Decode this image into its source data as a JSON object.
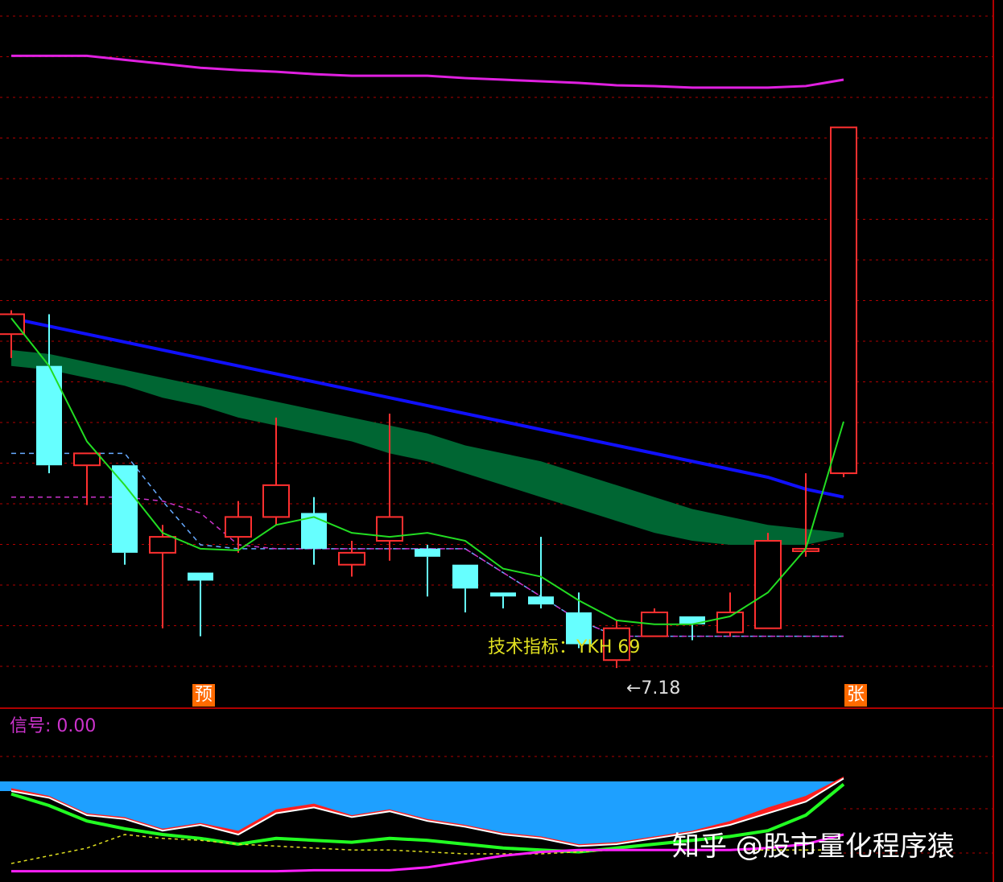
{
  "colors": {
    "background": "#000000",
    "grid": "#b00000",
    "up": "#ff3030",
    "down": "#66ffff",
    "ma_fast": "#22dd22",
    "ma_long": "#1010ff",
    "band": "#006633",
    "upper": "#e020e0",
    "support": "#cc33cc",
    "stop": "#66aaff",
    "label_bg": "#ff6a00",
    "text_yellow": "#e0e020",
    "text_magenta": "#cc33cc",
    "text_white": "#dddddd",
    "blue_fill": "#1ea0ff",
    "red_fill": "#ff2020"
  },
  "main": {
    "markers": {
      "pre": "预",
      "rise": "张"
    },
    "indicator_label": "技术指标",
    "indicator_value": "YKH 69",
    "low_price_note": "←7.18"
  },
  "sub": {
    "signal_label": "信号",
    "signal_value": "0.00"
  },
  "watermark": "知乎 @股市量化程序猿",
  "chart_data": [
    {
      "type": "candlestick",
      "title": "",
      "xlabel": "",
      "ylabel": "",
      "ylim": [
        6.2,
        14.5
      ],
      "candles": [
        {
          "o": 10.5,
          "h": 10.8,
          "l": 10.2,
          "c": 10.75
        },
        {
          "o": 10.1,
          "h": 10.75,
          "l": 8.75,
          "c": 8.85
        },
        {
          "o": 8.85,
          "h": 9.0,
          "l": 8.35,
          "c": 9.0
        },
        {
          "o": 8.85,
          "h": 8.85,
          "l": 7.6,
          "c": 7.75
        },
        {
          "o": 7.75,
          "h": 8.1,
          "l": 6.8,
          "c": 7.95
        },
        {
          "o": 7.5,
          "h": 7.5,
          "l": 6.7,
          "c": 7.4
        },
        {
          "o": 7.95,
          "h": 8.4,
          "l": 7.75,
          "c": 8.2
        },
        {
          "o": 8.2,
          "h": 9.45,
          "l": 8.1,
          "c": 8.6
        },
        {
          "o": 8.25,
          "h": 8.45,
          "l": 7.6,
          "c": 7.8
        },
        {
          "o": 7.6,
          "h": 7.9,
          "l": 7.45,
          "c": 7.75
        },
        {
          "o": 7.9,
          "h": 9.5,
          "l": 7.65,
          "c": 8.2
        },
        {
          "o": 7.8,
          "h": 7.85,
          "l": 7.2,
          "c": 7.7
        },
        {
          "o": 7.6,
          "h": 7.6,
          "l": 7.0,
          "c": 7.3
        },
        {
          "o": 7.25,
          "h": 7.25,
          "l": 7.05,
          "c": 7.2
        },
        {
          "o": 7.2,
          "h": 7.95,
          "l": 7.05,
          "c": 7.1
        },
        {
          "o": 7.0,
          "h": 7.25,
          "l": 6.55,
          "c": 6.6
        },
        {
          "o": 6.4,
          "h": 6.9,
          "l": 6.3,
          "c": 6.8
        },
        {
          "o": 6.7,
          "h": 7.05,
          "l": 6.7,
          "c": 7.0
        },
        {
          "o": 6.95,
          "h": 6.95,
          "l": 6.65,
          "c": 6.85
        },
        {
          "o": 6.75,
          "h": 7.25,
          "l": 6.7,
          "c": 7.0
        },
        {
          "o": 6.8,
          "h": 8.0,
          "l": 6.8,
          "c": 7.9
        },
        {
          "o": 7.8,
          "h": 8.75,
          "l": 7.7,
          "c": 7.8
        },
        {
          "o": 8.75,
          "h": 13.1,
          "l": 8.7,
          "c": 13.1
        }
      ],
      "ma_fast": [
        10.7,
        10.1,
        9.15,
        8.6,
        8.0,
        7.8,
        7.78,
        8.1,
        8.2,
        8.0,
        7.95,
        8.0,
        7.9,
        7.55,
        7.45,
        7.15,
        6.9,
        6.85,
        6.85,
        6.95,
        7.25,
        7.8,
        9.4
      ],
      "ma_long": [
        10.7,
        10.6,
        10.5,
        10.4,
        10.3,
        10.2,
        10.1,
        10.0,
        9.9,
        9.8,
        9.7,
        9.6,
        9.5,
        9.4,
        9.3,
        9.2,
        9.1,
        9.0,
        8.9,
        8.8,
        8.7,
        8.55,
        8.45
      ],
      "band_upper": [
        10.3,
        10.25,
        10.15,
        10.05,
        9.95,
        9.85,
        9.75,
        9.65,
        9.55,
        9.45,
        9.35,
        9.25,
        9.1,
        9.0,
        8.9,
        8.75,
        8.6,
        8.45,
        8.3,
        8.2,
        8.1,
        8.05,
        8.0
      ],
      "band_lower": [
        10.1,
        10.05,
        9.95,
        9.85,
        9.7,
        9.6,
        9.45,
        9.35,
        9.25,
        9.15,
        9.0,
        8.9,
        8.75,
        8.6,
        8.45,
        8.3,
        8.15,
        8.0,
        7.9,
        7.85,
        7.85,
        7.85,
        7.95
      ],
      "upper_line": [
        14.0,
        14.0,
        14.0,
        13.95,
        13.9,
        13.85,
        13.82,
        13.8,
        13.77,
        13.75,
        13.75,
        13.75,
        13.72,
        13.7,
        13.68,
        13.66,
        13.63,
        13.62,
        13.6,
        13.6,
        13.6,
        13.62,
        13.7
      ],
      "stop_line": [
        9.0,
        9.0,
        9.0,
        9.0,
        8.4,
        7.85,
        7.8,
        7.8,
        7.8,
        7.8,
        7.8,
        7.8,
        7.8,
        7.5,
        7.2,
        6.9,
        6.7,
        6.7,
        6.7,
        6.7,
        6.7,
        6.7,
        6.7
      ],
      "support_line": [
        8.45,
        8.45,
        8.45,
        8.45,
        8.4,
        8.25,
        7.85,
        7.8,
        7.8,
        7.8,
        7.8,
        7.8,
        7.8,
        7.5,
        7.2,
        6.9,
        6.7,
        6.7,
        6.7,
        6.7,
        6.7,
        6.7,
        6.7
      ]
    },
    {
      "type": "area",
      "title": "",
      "ylim": [
        0,
        100
      ],
      "blue_level": 95,
      "white": [
        85,
        78,
        60,
        56,
        44,
        50,
        40,
        62,
        68,
        58,
        64,
        54,
        48,
        40,
        36,
        28,
        30,
        36,
        42,
        50,
        62,
        74,
        98
      ],
      "red": [
        88,
        80,
        62,
        58,
        46,
        52,
        44,
        66,
        72,
        60,
        66,
        56,
        50,
        42,
        38,
        30,
        32,
        38,
        44,
        54,
        68,
        80,
        100
      ],
      "green": [
        82,
        70,
        54,
        46,
        40,
        36,
        30,
        36,
        34,
        32,
        36,
        34,
        30,
        26,
        24,
        22,
        26,
        30,
        34,
        38,
        44,
        60,
        92
      ],
      "yellow": [
        10,
        18,
        26,
        40,
        36,
        34,
        30,
        28,
        26,
        24,
        24,
        22,
        20,
        20,
        20,
        22,
        24,
        24,
        24,
        24,
        24,
        24,
        24
      ],
      "magenta": [
        2,
        2,
        2,
        2,
        2,
        2,
        2,
        2,
        3,
        3,
        3,
        6,
        12,
        18,
        22,
        24,
        24,
        24,
        24,
        24,
        26,
        30,
        40
      ]
    }
  ]
}
